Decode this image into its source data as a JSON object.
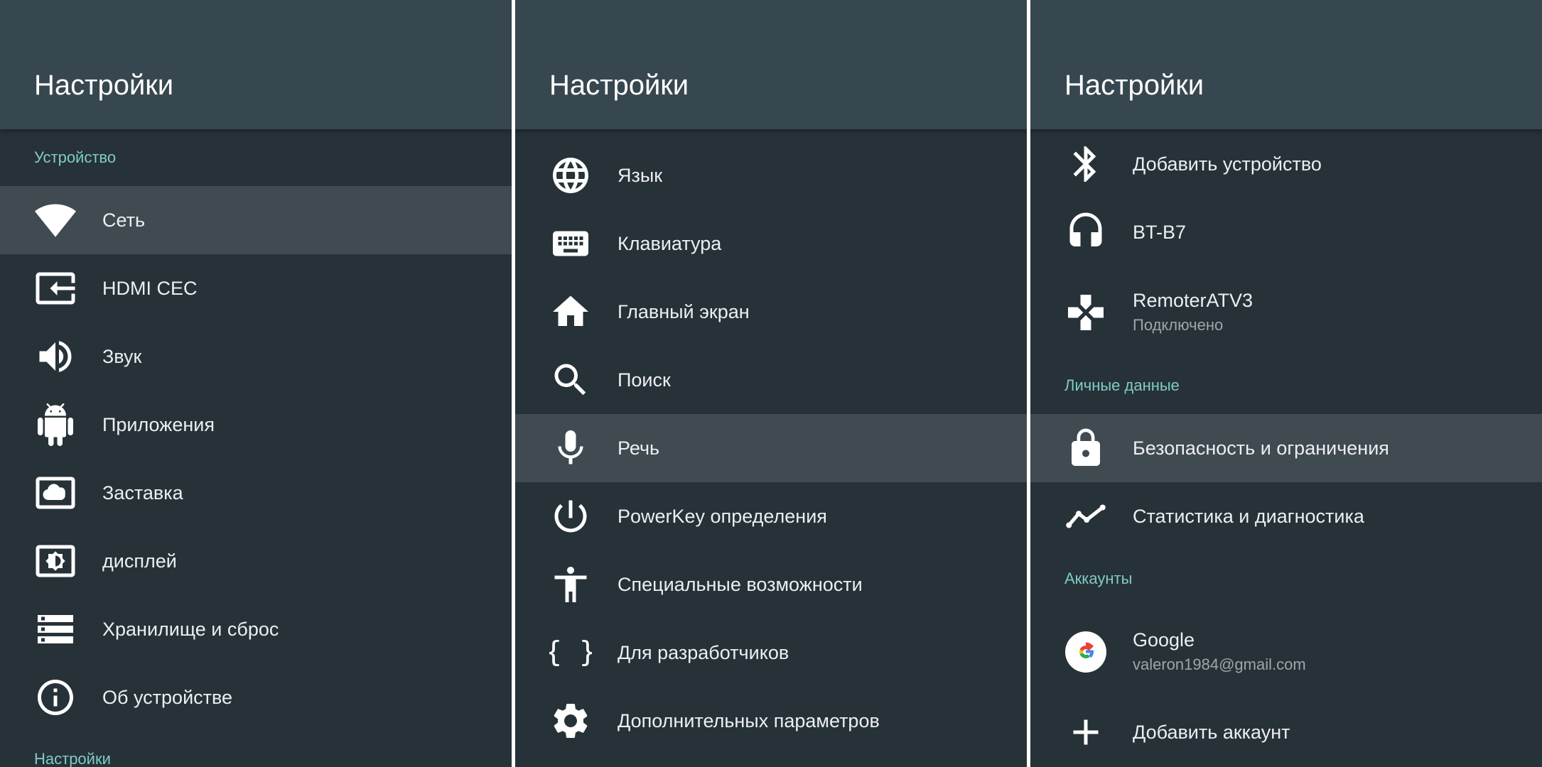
{
  "panel1": {
    "title": "Настройки",
    "section_device": "Устройство",
    "section_settings": "Настройки",
    "items": [
      {
        "label": "Сеть",
        "icon": "wifi-icon"
      },
      {
        "label": "HDMI CEC",
        "icon": "input-icon"
      },
      {
        "label": "Звук",
        "icon": "volume-icon"
      },
      {
        "label": "Приложения",
        "icon": "android-icon"
      },
      {
        "label": "Заставка",
        "icon": "screensaver-icon"
      },
      {
        "label": "дисплей",
        "icon": "display-brightness-icon"
      },
      {
        "label": "Хранилище и сброс",
        "icon": "storage-icon"
      },
      {
        "label": "Об устройстве",
        "icon": "info-icon"
      }
    ]
  },
  "panel2": {
    "title": "Настройки",
    "items": [
      {
        "label": "Язык",
        "icon": "globe-icon"
      },
      {
        "label": "Клавиатура",
        "icon": "keyboard-icon"
      },
      {
        "label": "Главный экран",
        "icon": "home-icon"
      },
      {
        "label": "Поиск",
        "icon": "search-icon"
      },
      {
        "label": "Речь",
        "icon": "mic-icon"
      },
      {
        "label": "PowerKey определения",
        "icon": "power-icon"
      },
      {
        "label": "Специальные возможности",
        "icon": "accessibility-icon"
      },
      {
        "label": "Для разработчиков",
        "icon": "braces-icon"
      },
      {
        "label": "Дополнительных параметров",
        "icon": "gear-icon"
      }
    ]
  },
  "panel3": {
    "title": "Настройки",
    "section_personal": "Личные данные",
    "section_accounts": "Аккаунты",
    "items": [
      {
        "label": "Добавить устройство",
        "icon": "bluetooth-icon"
      },
      {
        "label": "BT-B7",
        "icon": "headphones-icon"
      },
      {
        "label": "RemoterATV3",
        "sub": "Подключено",
        "icon": "gamepad-icon"
      },
      {
        "label": "Безопасность и ограничения",
        "icon": "lock-icon"
      },
      {
        "label": "Статистика и диагностика",
        "icon": "stats-icon"
      },
      {
        "label": "Google",
        "sub": "valeron1984@gmail.com",
        "icon": "google-icon"
      },
      {
        "label": "Добавить аккаунт",
        "icon": "plus-icon"
      }
    ]
  },
  "selected": {
    "panel1": "Сеть",
    "panel2": "Речь",
    "panel3": "Безопасность и ограничения"
  },
  "colors": {
    "background": "#263238",
    "header": "#37474f",
    "selected_row": "#3f4a51",
    "section_text": "#80cbc4",
    "divider": "#ffffff"
  }
}
